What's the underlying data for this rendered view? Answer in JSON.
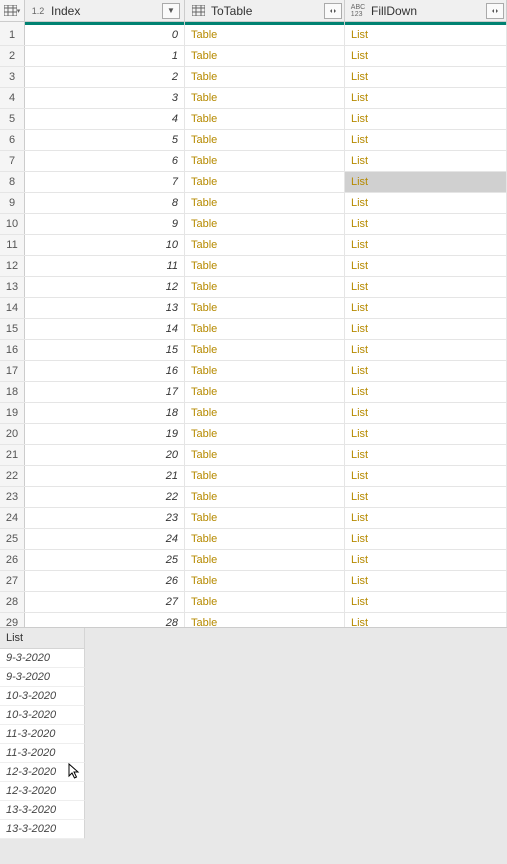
{
  "columns": {
    "index": {
      "label": "Index",
      "type_icon": "1.2"
    },
    "totable": {
      "label": "ToTable"
    },
    "filldown": {
      "label": "FillDown",
      "type_icon": "ABC 123"
    }
  },
  "rows": [
    {
      "n": "1",
      "index": "0",
      "totable": "Table",
      "filldown": "List"
    },
    {
      "n": "2",
      "index": "1",
      "totable": "Table",
      "filldown": "List"
    },
    {
      "n": "3",
      "index": "2",
      "totable": "Table",
      "filldown": "List"
    },
    {
      "n": "4",
      "index": "3",
      "totable": "Table",
      "filldown": "List"
    },
    {
      "n": "5",
      "index": "4",
      "totable": "Table",
      "filldown": "List"
    },
    {
      "n": "6",
      "index": "5",
      "totable": "Table",
      "filldown": "List"
    },
    {
      "n": "7",
      "index": "6",
      "totable": "Table",
      "filldown": "List"
    },
    {
      "n": "8",
      "index": "7",
      "totable": "Table",
      "filldown": "List",
      "selected": true
    },
    {
      "n": "9",
      "index": "8",
      "totable": "Table",
      "filldown": "List"
    },
    {
      "n": "10",
      "index": "9",
      "totable": "Table",
      "filldown": "List"
    },
    {
      "n": "11",
      "index": "10",
      "totable": "Table",
      "filldown": "List"
    },
    {
      "n": "12",
      "index": "11",
      "totable": "Table",
      "filldown": "List"
    },
    {
      "n": "13",
      "index": "12",
      "totable": "Table",
      "filldown": "List"
    },
    {
      "n": "14",
      "index": "13",
      "totable": "Table",
      "filldown": "List"
    },
    {
      "n": "15",
      "index": "14",
      "totable": "Table",
      "filldown": "List"
    },
    {
      "n": "16",
      "index": "15",
      "totable": "Table",
      "filldown": "List"
    },
    {
      "n": "17",
      "index": "16",
      "totable": "Table",
      "filldown": "List"
    },
    {
      "n": "18",
      "index": "17",
      "totable": "Table",
      "filldown": "List"
    },
    {
      "n": "19",
      "index": "18",
      "totable": "Table",
      "filldown": "List"
    },
    {
      "n": "20",
      "index": "19",
      "totable": "Table",
      "filldown": "List"
    },
    {
      "n": "21",
      "index": "20",
      "totable": "Table",
      "filldown": "List"
    },
    {
      "n": "22",
      "index": "21",
      "totable": "Table",
      "filldown": "List"
    },
    {
      "n": "23",
      "index": "22",
      "totable": "Table",
      "filldown": "List"
    },
    {
      "n": "24",
      "index": "23",
      "totable": "Table",
      "filldown": "List"
    },
    {
      "n": "25",
      "index": "24",
      "totable": "Table",
      "filldown": "List"
    },
    {
      "n": "26",
      "index": "25",
      "totable": "Table",
      "filldown": "List"
    },
    {
      "n": "27",
      "index": "26",
      "totable": "Table",
      "filldown": "List"
    },
    {
      "n": "28",
      "index": "27",
      "totable": "Table",
      "filldown": "List"
    },
    {
      "n": "29",
      "index": "28",
      "totable": "Table",
      "filldown": "List"
    }
  ],
  "preview": {
    "title": "List",
    "items": [
      "9-3-2020",
      "9-3-2020",
      "10-3-2020",
      "10-3-2020",
      "11-3-2020",
      "11-3-2020",
      "12-3-2020",
      "12-3-2020",
      "13-3-2020",
      "13-3-2020"
    ]
  }
}
